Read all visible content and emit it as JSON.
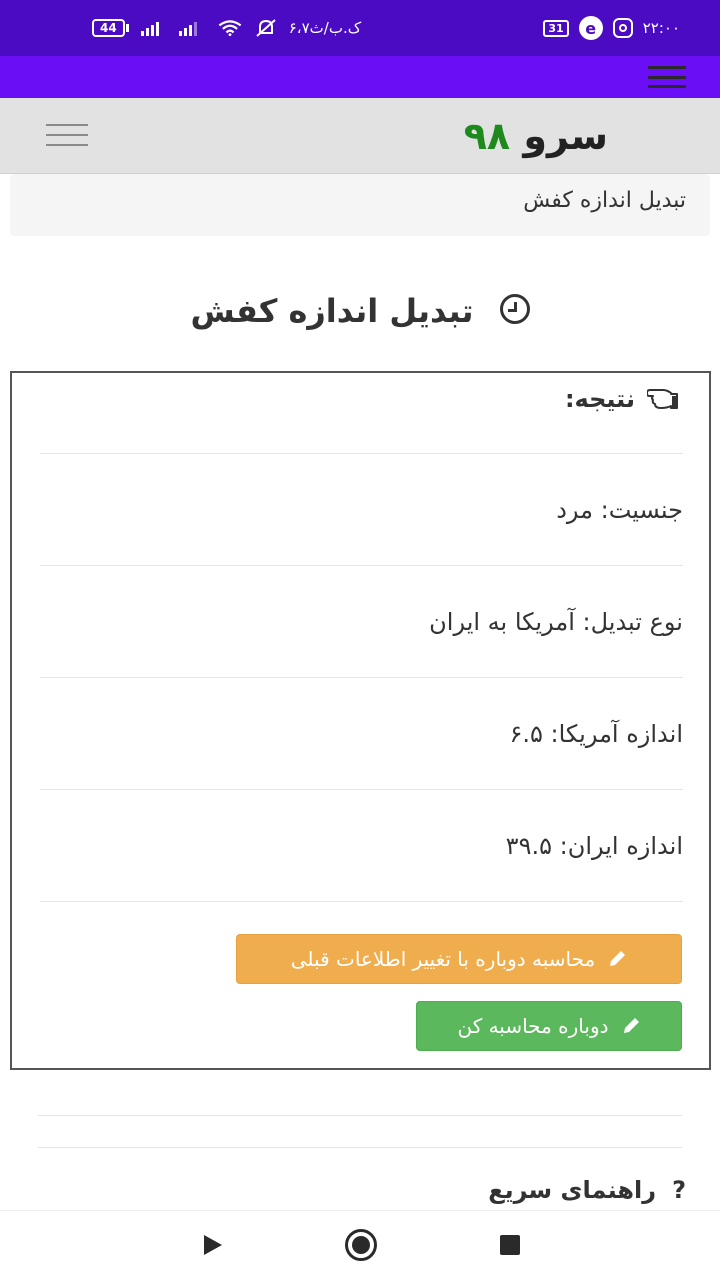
{
  "status_bar": {
    "time": "۲۲:۰۰",
    "calendar_day": "31",
    "data_speed": "۶،۷ک.ب/ث",
    "battery": "44"
  },
  "header": {
    "brand_name": "سرو",
    "brand_number": "۹۸"
  },
  "breadcrumb": {
    "text": "تبدیل اندازه کفش"
  },
  "page": {
    "title": "تبدیل اندازه کفش"
  },
  "result": {
    "heading": "نتیجه:",
    "rows": [
      {
        "text": "جنسیت: مرد"
      },
      {
        "text": "نوع تبدیل: آمریکا به ایران"
      },
      {
        "text": "اندازه آمریکا: ۶.۵"
      },
      {
        "text": "اندازه ایران: ۳۹.۵"
      }
    ],
    "recalc_change_label": "محاسبه دوباره با تغییر اطلاعات قبلی",
    "recalc_label": "دوباره محاسبه کن"
  },
  "guide": {
    "title": "راهنمای سریع",
    "icon_text": "?"
  },
  "colors": {
    "status_bar": "#4a0bc2",
    "toolbar": "#6a0ff5",
    "brand_number": "#1e8a1e",
    "warning_button": "#f0ad4e",
    "success_button": "#5cb85c"
  },
  "icons": {
    "title_icon": "clock-icon",
    "result_icon": "hand-point-left-icon",
    "button_icon": "pencil-icon",
    "guide_icon": "question-icon"
  }
}
